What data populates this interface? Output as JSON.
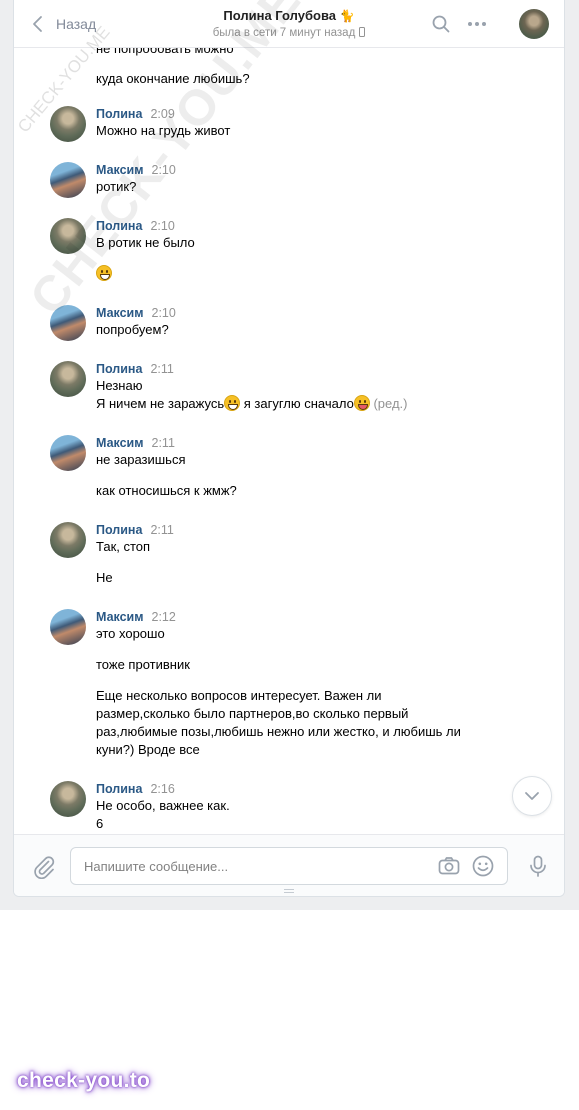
{
  "header": {
    "back_label": "Назад",
    "title": "Полина Голубова",
    "title_emoji": "🐈",
    "status": "была в сети 7 минут назад"
  },
  "top_fragment": {
    "partial": "не попробовать можно",
    "line": "куда окончание любишь?"
  },
  "messages": [
    {
      "author": "Полина",
      "time": "2:09",
      "lines": [
        "Можно на грудь живот"
      ]
    },
    {
      "author": "Максим",
      "time": "2:10",
      "lines": [
        "ротик?"
      ]
    },
    {
      "author": "Полина",
      "time": "2:10",
      "lines": [
        "В ротик не было"
      ]
    },
    {
      "author": "Максим",
      "time": "2:10",
      "lines": [
        "попробуем?"
      ]
    },
    {
      "author": "Полина",
      "time": "2:11",
      "lines": [
        "Незнаю",
        "Я ничем не заражусь",
        "я загуглю сначало",
        "(ред.)"
      ]
    },
    {
      "author": "Максим",
      "time": "2:11",
      "lines": [
        "не заразишься",
        "как относишься к жмж?"
      ]
    },
    {
      "author": "Полина",
      "time": "2:11",
      "lines": [
        "Так, стоп",
        "Не"
      ]
    },
    {
      "author": "Максим",
      "time": "2:12",
      "lines": [
        "это хорошо",
        "тоже противник",
        "Еще несколько вопросов интересует. Важен ли размер,сколько было партнеров,во сколько первый раз,любимые позы,любишь нежно или жестко, и любишь ли куни?) Вроде все"
      ]
    },
    {
      "author": "Полина",
      "time": "2:16",
      "lines": [
        "Не особо, важнее как.",
        "6"
      ]
    }
  ],
  "composer": {
    "placeholder": "Напишите сообщение..."
  },
  "watermarks": {
    "diagonal": "CHECK-YOU.ME",
    "small": "CHECK-YOU.ME",
    "brand": "check-you.to"
  },
  "icons": {
    "back": "chevron-left-icon",
    "search": "search-icon",
    "more": "more-dots-icon",
    "attach": "paperclip-icon",
    "camera": "camera-icon",
    "emoji": "smile-icon",
    "mic": "microphone-icon",
    "scroll": "chevron-down-icon"
  },
  "colors": {
    "link": "#2a5885",
    "muted": "#939393",
    "page_bg": "#edeef0"
  }
}
